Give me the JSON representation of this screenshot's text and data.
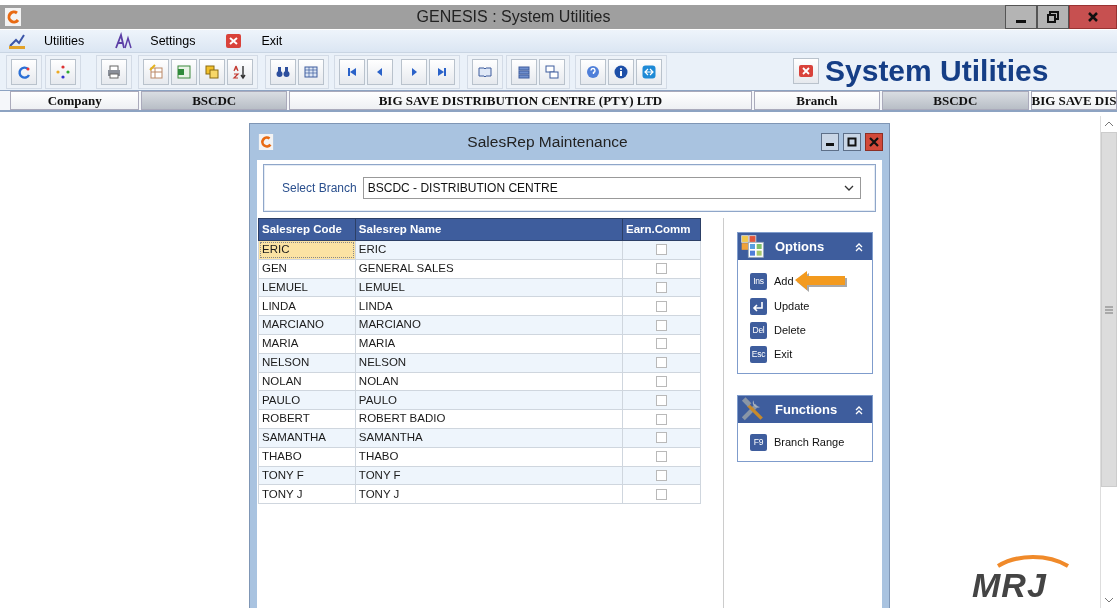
{
  "window": {
    "title": "GENESIS : System Utilities"
  },
  "menu": [
    {
      "label": "Utilities",
      "kind": "chart"
    },
    {
      "label": "Settings",
      "kind": "font"
    },
    {
      "label": "Exit",
      "kind": "exit"
    }
  ],
  "banner": {
    "title": "System Utilities"
  },
  "info_strip": [
    {
      "text": "Company",
      "kind": "label"
    },
    {
      "text": "BSCDC",
      "kind": "value"
    },
    {
      "text": "BIG SAVE DISTRIBUTION CENTRE (PTY) LTD",
      "kind": "label"
    },
    {
      "text": "Branch",
      "kind": "label"
    },
    {
      "text": "BSCDC",
      "kind": "value"
    },
    {
      "text": "BIG SAVE DIS",
      "kind": "label"
    }
  ],
  "dialog": {
    "title": "SalesRep Maintenance",
    "branch_label": "Select Branch",
    "branch_value": "BSCDC - DISTRIBUTION CENTRE",
    "table": {
      "columns": [
        "Salesrep Code",
        "Salesrep Name",
        "Earn.Comm"
      ],
      "rows": [
        {
          "code": "ERIC",
          "name": "ERIC",
          "earn_comm": false,
          "selected": true
        },
        {
          "code": "GEN",
          "name": "GENERAL SALES",
          "earn_comm": false,
          "selected": false
        },
        {
          "code": "LEMUEL",
          "name": "LEMUEL",
          "earn_comm": false,
          "selected": false
        },
        {
          "code": "LINDA",
          "name": "LINDA",
          "earn_comm": false,
          "selected": false
        },
        {
          "code": "MARCIANO",
          "name": "MARCIANO",
          "earn_comm": false,
          "selected": false
        },
        {
          "code": "MARIA",
          "name": "MARIA",
          "earn_comm": false,
          "selected": false
        },
        {
          "code": "NELSON",
          "name": "NELSON",
          "earn_comm": false,
          "selected": false
        },
        {
          "code": "NOLAN",
          "name": "NOLAN",
          "earn_comm": false,
          "selected": false
        },
        {
          "code": "PAULO",
          "name": "PAULO",
          "earn_comm": false,
          "selected": false
        },
        {
          "code": "ROBERT",
          "name": "ROBERT BADIO",
          "earn_comm": false,
          "selected": false
        },
        {
          "code": "SAMANTHA",
          "name": "SAMANTHA",
          "earn_comm": false,
          "selected": false
        },
        {
          "code": "THABO",
          "name": "THABO",
          "earn_comm": false,
          "selected": false
        },
        {
          "code": "TONY F",
          "name": "TONY F",
          "earn_comm": false,
          "selected": false
        },
        {
          "code": "TONY J",
          "name": "TONY J",
          "earn_comm": false,
          "selected": false
        }
      ]
    },
    "panels": [
      {
        "title": "Options",
        "kind": "options",
        "expanded": true,
        "items": [
          {
            "kind": "key",
            "key": "Ins",
            "label": "Add",
            "pointed": true
          },
          {
            "kind": "enter",
            "label": "Update",
            "pointed": false
          },
          {
            "kind": "key",
            "key": "Del",
            "label": "Delete",
            "pointed": false
          },
          {
            "kind": "key",
            "key": "Esc",
            "label": "Exit",
            "pointed": false
          }
        ]
      },
      {
        "title": "Functions",
        "kind": "tools",
        "expanded": true,
        "items": [
          {
            "kind": "key",
            "key": "F9",
            "label": "Branch Range",
            "pointed": false
          }
        ]
      }
    ]
  },
  "logo": {
    "text": "MRJ"
  }
}
